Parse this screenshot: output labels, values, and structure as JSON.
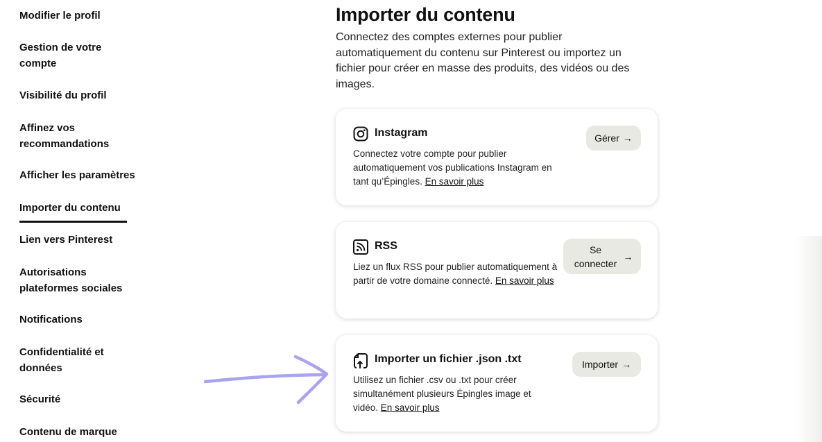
{
  "sidebar": {
    "items": [
      {
        "label": "Modifier le profil"
      },
      {
        "label": "Gestion de votre compte"
      },
      {
        "label": "Visibilité du profil"
      },
      {
        "label": "Affinez vos recommandations"
      },
      {
        "label": "Afficher les paramètres"
      },
      {
        "label": "Importer du contenu",
        "active": true
      },
      {
        "label": "Lien vers Pinterest"
      },
      {
        "label": "Autorisations plateformes sociales"
      },
      {
        "label": "Notifications"
      },
      {
        "label": "Confidentialité et données"
      },
      {
        "label": "Sécurité"
      },
      {
        "label": "Contenu de marque"
      }
    ]
  },
  "main": {
    "title": "Importer du contenu",
    "description": "Connectez des comptes externes pour publier automatiquement du contenu sur Pinterest ou importez un fichier pour créer en masse des produits, des vidéos ou des images.",
    "cards": [
      {
        "icon": "instagram-icon",
        "title": "Instagram",
        "description": "Connectez votre compte pour publier automatiquement vos publications Instagram en tant qu’Épingles.",
        "link": "En savoir plus",
        "button": "Gérer",
        "button_arrow": "→"
      },
      {
        "icon": "rss-icon",
        "title": "RSS",
        "description": "Liez un flux RSS pour publier automatiquement à partir de votre domaine connecté.",
        "link": "En savoir plus",
        "button": "Se connecter",
        "button_arrow": "→"
      },
      {
        "icon": "file-upload-icon",
        "title": "Importer un fichier .json .txt",
        "description": "Utilisez un fichier .csv ou .txt pour créer simultanément plusieurs Épingles image et vidéo.",
        "link": "En savoir plus",
        "button": "Importer",
        "button_arrow": "→"
      }
    ]
  },
  "annotation": {
    "icon": "hand-drawn-arrow",
    "color": "#a9a3f0"
  }
}
